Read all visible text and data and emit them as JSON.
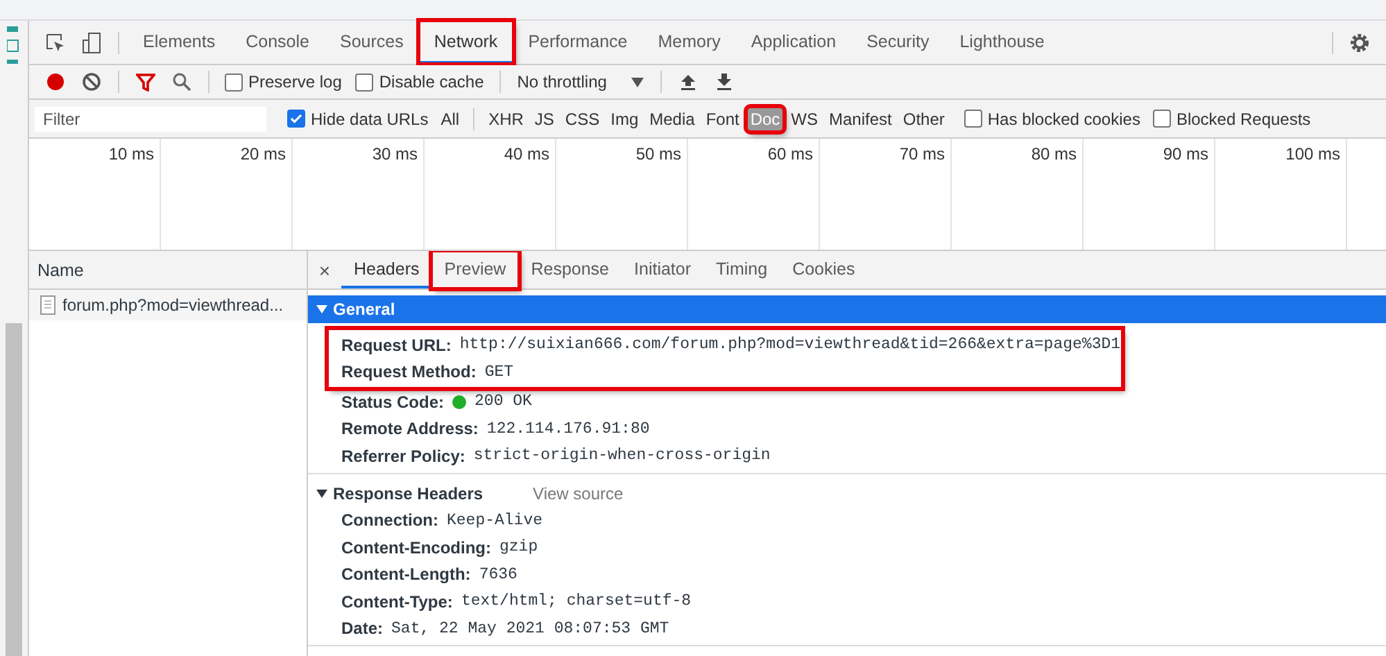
{
  "panel_tabs": [
    {
      "label": "Elements",
      "selected": false,
      "highlighted": false
    },
    {
      "label": "Console",
      "selected": false,
      "highlighted": false
    },
    {
      "label": "Sources",
      "selected": false,
      "highlighted": false
    },
    {
      "label": "Network",
      "selected": true,
      "highlighted": true
    },
    {
      "label": "Performance",
      "selected": false,
      "highlighted": false
    },
    {
      "label": "Memory",
      "selected": false,
      "highlighted": false
    },
    {
      "label": "Application",
      "selected": false,
      "highlighted": false
    },
    {
      "label": "Security",
      "selected": false,
      "highlighted": false
    },
    {
      "label": "Lighthouse",
      "selected": false,
      "highlighted": false
    }
  ],
  "toolbar": {
    "recording": true,
    "options": [
      {
        "label": "Preserve log",
        "checked": false
      },
      {
        "label": "Disable cache",
        "checked": false
      }
    ],
    "throttling": "No throttling"
  },
  "filter": {
    "placeholder": "Filter",
    "hide_data_urls": {
      "label": "Hide data URLs",
      "checked": true
    },
    "types": [
      {
        "label": "All",
        "selected": false,
        "highlighted": false
      },
      {
        "label": "XHR",
        "selected": false,
        "highlighted": false
      },
      {
        "label": "JS",
        "selected": false,
        "highlighted": false
      },
      {
        "label": "CSS",
        "selected": false,
        "highlighted": false
      },
      {
        "label": "Img",
        "selected": false,
        "highlighted": false
      },
      {
        "label": "Media",
        "selected": false,
        "highlighted": false
      },
      {
        "label": "Font",
        "selected": false,
        "highlighted": false
      },
      {
        "label": "Doc",
        "selected": true,
        "highlighted": true
      },
      {
        "label": "WS",
        "selected": false,
        "highlighted": false
      },
      {
        "label": "Manifest",
        "selected": false,
        "highlighted": false
      },
      {
        "label": "Other",
        "selected": false,
        "highlighted": false
      }
    ],
    "options": [
      {
        "label": "Has blocked cookies",
        "checked": false
      },
      {
        "label": "Blocked Requests",
        "checked": false
      }
    ]
  },
  "timeline": {
    "ticks": [
      "10 ms",
      "20 ms",
      "30 ms",
      "40 ms",
      "50 ms",
      "60 ms",
      "70 ms",
      "80 ms",
      "90 ms",
      "100 ms"
    ]
  },
  "requests": {
    "column": "Name",
    "rows": [
      {
        "name": "forum.php?mod=viewthread..."
      }
    ]
  },
  "details": {
    "close": "×",
    "tabs": [
      {
        "label": "Headers",
        "selected": true,
        "highlighted": false
      },
      {
        "label": "Preview",
        "selected": false,
        "highlighted": true
      },
      {
        "label": "Response",
        "selected": false,
        "highlighted": false
      },
      {
        "label": "Initiator",
        "selected": false,
        "highlighted": false
      },
      {
        "label": "Timing",
        "selected": false,
        "highlighted": false
      },
      {
        "label": "Cookies",
        "selected": false,
        "highlighted": false
      }
    ],
    "sections": [
      {
        "title": "General",
        "expanded": true,
        "focused": true,
        "fields": [
          {
            "name": "Request URL:",
            "value": "http://suixian666.com/forum.php?mod=viewthread&tid=266&extra=page%3D1",
            "highlighted": true
          },
          {
            "name": "Request Method:",
            "value": "GET",
            "highlighted": true
          },
          {
            "name": "Status Code:",
            "value": "200 OK",
            "highlighted": false,
            "color": "#1fae2a"
          },
          {
            "name": "Remote Address:",
            "value": "122.114.176.91:80",
            "highlighted": false
          },
          {
            "name": "Referrer Policy:",
            "value": "strict-origin-when-cross-origin",
            "highlighted": false
          }
        ]
      },
      {
        "title": "Response Headers",
        "expanded": true,
        "focused": false,
        "link": "View source",
        "fields": [
          {
            "name": "Connection:",
            "value": "Keep-Alive",
            "highlighted": false
          },
          {
            "name": "Content-Encoding:",
            "value": "gzip",
            "highlighted": false
          },
          {
            "name": "Content-Length:",
            "value": "7636",
            "highlighted": false
          },
          {
            "name": "Content-Type:",
            "value": "text/html; charset=utf-8",
            "highlighted": false
          },
          {
            "name": "Date:",
            "value": "Sat, 22 May 2021 08:07:53 GMT",
            "highlighted": false
          }
        ]
      }
    ]
  }
}
